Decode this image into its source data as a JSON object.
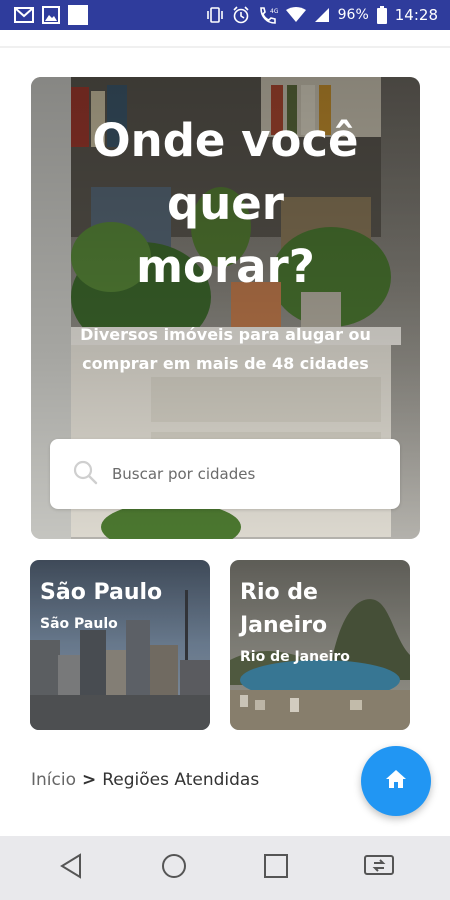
{
  "status_bar": {
    "time": "14:28",
    "battery": "96%",
    "background_color": "#2f3c9c",
    "left_icons": [
      "gmail-icon",
      "gallery-icon",
      "white-square-icon"
    ],
    "right_icons": [
      "vibrate-icon",
      "alarm-icon",
      "call-hd-icon",
      "wifi-icon",
      "signal-icon",
      "battery-icon"
    ]
  },
  "hero": {
    "title": "Onde você\nquer\nmorar?",
    "subtitle": "Diversos imóveis para alugar ou comprar em mais de 48 cidades",
    "search": {
      "placeholder": "Buscar por cidades",
      "value": ""
    }
  },
  "cities": [
    {
      "name": "São Paulo",
      "state": "São Paulo"
    },
    {
      "name": "Rio de Janeiro",
      "state": "Rio de Janeiro"
    }
  ],
  "breadcrumb": {
    "home": "Início",
    "separator": ">",
    "current": "Regiões Atendidas"
  },
  "fab": {
    "icon": "home-icon",
    "color": "#2196f3"
  },
  "nav_bar": {
    "buttons": [
      "back-icon",
      "home-circle-icon",
      "recents-icon",
      "screen-rotate-icon"
    ]
  }
}
